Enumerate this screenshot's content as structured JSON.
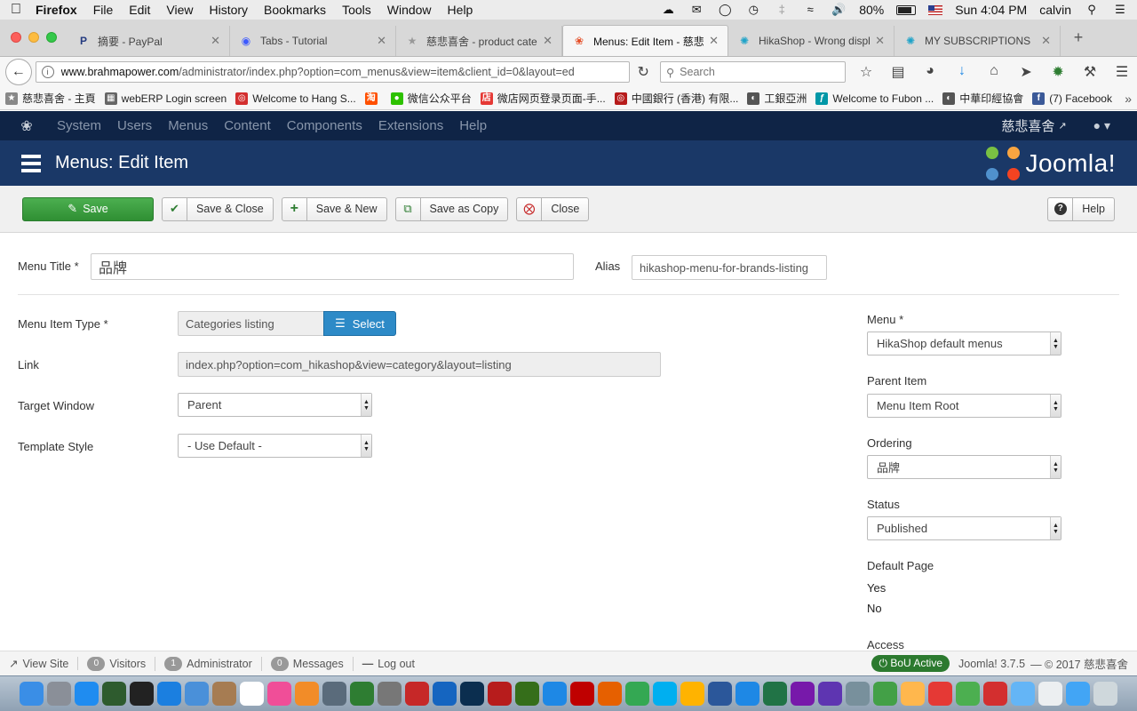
{
  "mac_menubar": {
    "app_name": "Firefox",
    "menus": [
      "File",
      "Edit",
      "View",
      "History",
      "Bookmarks",
      "Tools",
      "Window",
      "Help"
    ],
    "battery": "80%",
    "clock": "Sun 4:04 PM",
    "user": "calvin"
  },
  "browser": {
    "tabs": [
      {
        "label": "摘要 - PayPal",
        "icon": "paypal-icon",
        "color": "#253b80"
      },
      {
        "label": "Tabs - Tutorial",
        "icon": "shield-icon",
        "color": "#3d5afe"
      },
      {
        "label": "慈悲喜舍 - product catego",
        "icon": "site-icon",
        "color": "#999999"
      },
      {
        "label": "Menus: Edit Item - 慈悲喜",
        "icon": "joomla-icon",
        "color": "#e44d26",
        "active": true
      },
      {
        "label": "HikaShop - Wrong display",
        "icon": "hikashop-icon",
        "color": "#1fa3c8"
      },
      {
        "label": "MY SUBSCRIPTIONS",
        "icon": "hikashop-icon",
        "color": "#1fa3c8"
      }
    ],
    "url_host": "www.brahmapower.com",
    "url_path": "/administrator/index.php?option=com_menus&view=item&client_id=0&layout=ed",
    "search_placeholder": "Search",
    "bookmarks": [
      {
        "label": "慈悲喜舍 - 主頁",
        "icon": "site-icon",
        "color": "#888888"
      },
      {
        "label": "webERP Login screen",
        "icon": "grid-icon",
        "color": "#666666"
      },
      {
        "label": "Welcome to Hang S...",
        "icon": "bank-icon",
        "color": "#d32f2f"
      },
      {
        "label": "",
        "icon": "taobao-icon",
        "color": "#ff5000"
      },
      {
        "label": "微信公众平台",
        "icon": "wechat-icon",
        "color": "#2dc100"
      },
      {
        "label": "微店网页登录页面-手...",
        "icon": "shop-icon",
        "color": "#e53935"
      },
      {
        "label": "中國銀行 (香港) 有限...",
        "icon": "bank-icon",
        "color": "#b71c1c"
      },
      {
        "label": "工銀亞洲",
        "icon": "globe-icon",
        "color": "#555555"
      },
      {
        "label": "Welcome to Fubon ...",
        "icon": "fubon-icon",
        "color": "#0097a7"
      },
      {
        "label": "中華印經協會",
        "icon": "globe-icon",
        "color": "#555555"
      },
      {
        "label": "(7) Facebook",
        "icon": "facebook-icon",
        "color": "#3b5998"
      }
    ]
  },
  "joomla": {
    "nav": [
      "System",
      "Users",
      "Menus",
      "Content",
      "Components",
      "Extensions",
      "Help"
    ],
    "site_name": "慈悲喜舍",
    "page_title": "Menus: Edit Item",
    "brand": "Joomla!",
    "toolbar": {
      "save": "Save",
      "save_close": "Save & Close",
      "save_new": "Save & New",
      "save_copy": "Save as Copy",
      "close": "Close",
      "help": "Help"
    },
    "form": {
      "menu_title_label": "Menu Title *",
      "menu_title_value": "品牌",
      "alias_label": "Alias",
      "alias_value": "hikashop-menu-for-brands-listing",
      "type_label": "Menu Item Type *",
      "type_value": "Categories listing",
      "select_label": "Select",
      "link_label": "Link",
      "link_value": "index.php?option=com_hikashop&view=category&layout=listing",
      "target_label": "Target Window",
      "target_value": "Parent",
      "template_label": "Template Style",
      "template_value": "- Use Default -"
    },
    "sidebar": {
      "menu_label": "Menu *",
      "menu_value": "HikaShop default menus",
      "parent_label": "Parent Item",
      "parent_value": "Menu Item Root",
      "ordering_label": "Ordering",
      "ordering_value": "品牌",
      "status_label": "Status",
      "status_value": "Published",
      "default_label": "Default Page",
      "default_yes": "Yes",
      "default_no": "No",
      "access_label": "Access"
    },
    "status_bar": {
      "view_site": "View Site",
      "visitors_count": "0",
      "visitors_label": "Visitors",
      "admin_count": "1",
      "admin_label": "Administrator",
      "messages_count": "0",
      "messages_label": "Messages",
      "logout": "Log out",
      "bou": "BoU Active",
      "version": "Joomla! 3.7.5",
      "copyright": "— © 2017 慈悲喜舍"
    }
  },
  "dock": [
    {
      "name": "finder-icon",
      "color": "#3a8ee6"
    },
    {
      "name": "launchpad-icon",
      "color": "#8a8f98"
    },
    {
      "name": "app-store-icon",
      "color": "#1f8cf0"
    },
    {
      "name": "mission-control-icon",
      "color": "#2e5b2e"
    },
    {
      "name": "dashboard-icon",
      "color": "#222222"
    },
    {
      "name": "safari-icon",
      "color": "#1b7fe0"
    },
    {
      "name": "preview-icon",
      "color": "#4a90d9"
    },
    {
      "name": "contacts-icon",
      "color": "#a67c52"
    },
    {
      "name": "calendar-icon",
      "color": "#ffffff"
    },
    {
      "name": "itunes-icon",
      "color": "#f04e98"
    },
    {
      "name": "ibooks-icon",
      "color": "#f28c28"
    },
    {
      "name": "tableplus-icon",
      "color": "#5a6b7b"
    },
    {
      "name": "time-machine-icon",
      "color": "#2e7d32"
    },
    {
      "name": "system-prefs-icon",
      "color": "#777777"
    },
    {
      "name": "toolbox-icon",
      "color": "#c62828"
    },
    {
      "name": "settings-icon",
      "color": "#1565c0"
    },
    {
      "name": "photoshop-icon",
      "color": "#0b2e4f"
    },
    {
      "name": "flash-icon",
      "color": "#b71c1c"
    },
    {
      "name": "dreamweaver-icon",
      "color": "#356e1a"
    },
    {
      "name": "onedrive-icon",
      "color": "#1e88e5"
    },
    {
      "name": "filezilla-icon",
      "color": "#bf0000"
    },
    {
      "name": "firefox-icon",
      "color": "#e66000"
    },
    {
      "name": "chrome-icon",
      "color": "#34a853"
    },
    {
      "name": "skype-icon",
      "color": "#00aff0"
    },
    {
      "name": "opera-icon",
      "color": "#ffb300"
    },
    {
      "name": "word-icon",
      "color": "#2b579a"
    },
    {
      "name": "word-alt-icon",
      "color": "#1e88e5"
    },
    {
      "name": "excel-icon",
      "color": "#217346"
    },
    {
      "name": "onenote-icon",
      "color": "#7719aa"
    },
    {
      "name": "cloud-icon",
      "color": "#5e35b1"
    },
    {
      "name": "printer-icon",
      "color": "#78909c"
    },
    {
      "name": "globe-icon",
      "color": "#43a047"
    },
    {
      "name": "photos-icon",
      "color": "#ffb74d"
    },
    {
      "name": "photo-browser-icon",
      "color": "#e53935"
    },
    {
      "name": "camera-icon",
      "color": "#4caf50"
    },
    {
      "name": "acrobat-icon",
      "color": "#d32f2f"
    },
    {
      "name": "applications-icon",
      "color": "#64b5f6"
    },
    {
      "name": "documents-icon",
      "color": "#eceff1"
    },
    {
      "name": "downloads-icon",
      "color": "#42a5f5"
    },
    {
      "name": "trash-icon",
      "color": "#cfd8dc"
    }
  ]
}
